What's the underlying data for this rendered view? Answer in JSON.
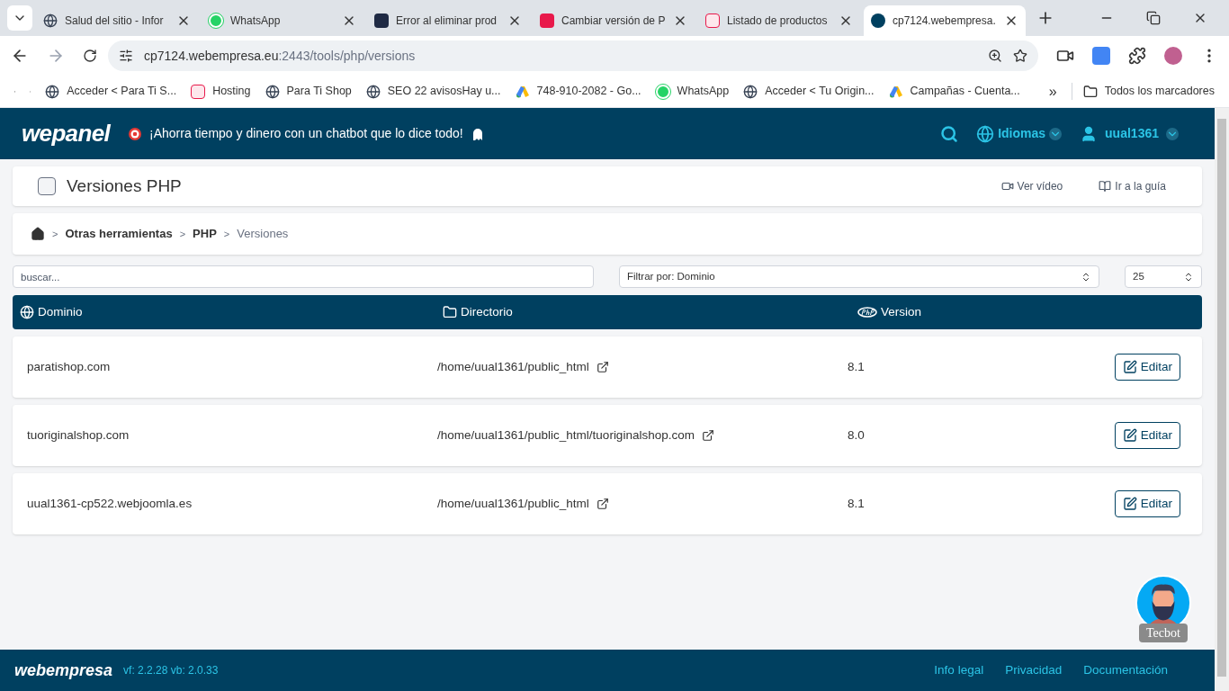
{
  "browser": {
    "tabs": [
      {
        "title": "Salud del sitio - Infor",
        "selected": false
      },
      {
        "title": "WhatsApp",
        "selected": false
      },
      {
        "title": "Error al eliminar prod",
        "selected": false
      },
      {
        "title": "Cambiar versión de P",
        "selected": false
      },
      {
        "title": "Listado de productos",
        "selected": false
      },
      {
        "title": "cp7124.webempresa.",
        "selected": true
      }
    ],
    "address": {
      "host": "cp7124.webempresa.eu",
      "path": ":2443/tools/php/versions"
    },
    "bookmarks": [
      "Acceder < Para Ti S...",
      "Hosting",
      "Para Ti Shop",
      "SEO 22 avisosHay u...",
      "748-910-2082 - Go...",
      "WhatsApp",
      "Acceder < Tu Origin...",
      "Campañas - Cuenta..."
    ],
    "more": "»",
    "all_bookmarks": "Todos los marcadores"
  },
  "header": {
    "logo": "wepanel",
    "promo": "¡Ahorra tiempo y dinero con un chatbot que lo dice todo!",
    "languages": "Idiomas",
    "user": "uual1361"
  },
  "page": {
    "title": "Versiones PHP",
    "links": [
      "Ver vídeo",
      "Ir a la guía"
    ]
  },
  "breadcrumb": [
    {
      "separator": ">",
      "label": "Otras herramientas",
      "kind": "link"
    },
    {
      "separator": ">",
      "label": "PHP",
      "kind": "link"
    },
    {
      "separator": ">",
      "label": "Versiones",
      "kind": "current"
    }
  ],
  "filters": {
    "search_placeholder": "buscar...",
    "filter": "Filtrar por: Dominio",
    "per_page": "25"
  },
  "table": {
    "columns": [
      "Dominio",
      "Directorio",
      "Version"
    ],
    "rows": [
      {
        "domain": "paratishop.com",
        "directory": "/home/uual1361/public_html",
        "version": "8.1",
        "action": "Editar"
      },
      {
        "domain": "tuoriginalshop.com",
        "directory": "/home/uual1361/public_html/tuoriginalshop.com",
        "version": "8.0",
        "action": "Editar"
      },
      {
        "domain": "uual1361-cp522.webjoomla.es",
        "directory": "/home/uual1361/public_html",
        "version": "8.1",
        "action": "Editar"
      }
    ]
  },
  "chatbot": {
    "label": "Tecbot"
  },
  "footer": {
    "logo": "webempresa",
    "version": "vf: 2.2.28 vb: 2.0.33",
    "links": [
      "Info legal",
      "Privacidad",
      "Documentación"
    ]
  }
}
